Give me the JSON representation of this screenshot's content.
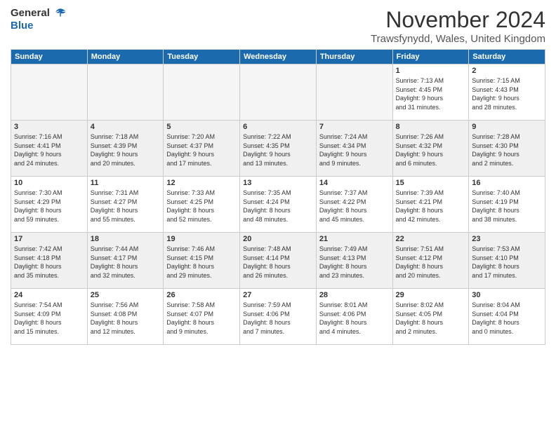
{
  "logo": {
    "line1": "General",
    "line2": "Blue"
  },
  "header": {
    "title": "November 2024",
    "location": "Trawsfynydd, Wales, United Kingdom"
  },
  "weekdays": [
    "Sunday",
    "Monday",
    "Tuesday",
    "Wednesday",
    "Thursday",
    "Friday",
    "Saturday"
  ],
  "weeks": [
    [
      {
        "day": "",
        "info": ""
      },
      {
        "day": "",
        "info": ""
      },
      {
        "day": "",
        "info": ""
      },
      {
        "day": "",
        "info": ""
      },
      {
        "day": "",
        "info": ""
      },
      {
        "day": "1",
        "info": "Sunrise: 7:13 AM\nSunset: 4:45 PM\nDaylight: 9 hours\nand 31 minutes."
      },
      {
        "day": "2",
        "info": "Sunrise: 7:15 AM\nSunset: 4:43 PM\nDaylight: 9 hours\nand 28 minutes."
      }
    ],
    [
      {
        "day": "3",
        "info": "Sunrise: 7:16 AM\nSunset: 4:41 PM\nDaylight: 9 hours\nand 24 minutes."
      },
      {
        "day": "4",
        "info": "Sunrise: 7:18 AM\nSunset: 4:39 PM\nDaylight: 9 hours\nand 20 minutes."
      },
      {
        "day": "5",
        "info": "Sunrise: 7:20 AM\nSunset: 4:37 PM\nDaylight: 9 hours\nand 17 minutes."
      },
      {
        "day": "6",
        "info": "Sunrise: 7:22 AM\nSunset: 4:35 PM\nDaylight: 9 hours\nand 13 minutes."
      },
      {
        "day": "7",
        "info": "Sunrise: 7:24 AM\nSunset: 4:34 PM\nDaylight: 9 hours\nand 9 minutes."
      },
      {
        "day": "8",
        "info": "Sunrise: 7:26 AM\nSunset: 4:32 PM\nDaylight: 9 hours\nand 6 minutes."
      },
      {
        "day": "9",
        "info": "Sunrise: 7:28 AM\nSunset: 4:30 PM\nDaylight: 9 hours\nand 2 minutes."
      }
    ],
    [
      {
        "day": "10",
        "info": "Sunrise: 7:30 AM\nSunset: 4:29 PM\nDaylight: 8 hours\nand 59 minutes."
      },
      {
        "day": "11",
        "info": "Sunrise: 7:31 AM\nSunset: 4:27 PM\nDaylight: 8 hours\nand 55 minutes."
      },
      {
        "day": "12",
        "info": "Sunrise: 7:33 AM\nSunset: 4:25 PM\nDaylight: 8 hours\nand 52 minutes."
      },
      {
        "day": "13",
        "info": "Sunrise: 7:35 AM\nSunset: 4:24 PM\nDaylight: 8 hours\nand 48 minutes."
      },
      {
        "day": "14",
        "info": "Sunrise: 7:37 AM\nSunset: 4:22 PM\nDaylight: 8 hours\nand 45 minutes."
      },
      {
        "day": "15",
        "info": "Sunrise: 7:39 AM\nSunset: 4:21 PM\nDaylight: 8 hours\nand 42 minutes."
      },
      {
        "day": "16",
        "info": "Sunrise: 7:40 AM\nSunset: 4:19 PM\nDaylight: 8 hours\nand 38 minutes."
      }
    ],
    [
      {
        "day": "17",
        "info": "Sunrise: 7:42 AM\nSunset: 4:18 PM\nDaylight: 8 hours\nand 35 minutes."
      },
      {
        "day": "18",
        "info": "Sunrise: 7:44 AM\nSunset: 4:17 PM\nDaylight: 8 hours\nand 32 minutes."
      },
      {
        "day": "19",
        "info": "Sunrise: 7:46 AM\nSunset: 4:15 PM\nDaylight: 8 hours\nand 29 minutes."
      },
      {
        "day": "20",
        "info": "Sunrise: 7:48 AM\nSunset: 4:14 PM\nDaylight: 8 hours\nand 26 minutes."
      },
      {
        "day": "21",
        "info": "Sunrise: 7:49 AM\nSunset: 4:13 PM\nDaylight: 8 hours\nand 23 minutes."
      },
      {
        "day": "22",
        "info": "Sunrise: 7:51 AM\nSunset: 4:12 PM\nDaylight: 8 hours\nand 20 minutes."
      },
      {
        "day": "23",
        "info": "Sunrise: 7:53 AM\nSunset: 4:10 PM\nDaylight: 8 hours\nand 17 minutes."
      }
    ],
    [
      {
        "day": "24",
        "info": "Sunrise: 7:54 AM\nSunset: 4:09 PM\nDaylight: 8 hours\nand 15 minutes."
      },
      {
        "day": "25",
        "info": "Sunrise: 7:56 AM\nSunset: 4:08 PM\nDaylight: 8 hours\nand 12 minutes."
      },
      {
        "day": "26",
        "info": "Sunrise: 7:58 AM\nSunset: 4:07 PM\nDaylight: 8 hours\nand 9 minutes."
      },
      {
        "day": "27",
        "info": "Sunrise: 7:59 AM\nSunset: 4:06 PM\nDaylight: 8 hours\nand 7 minutes."
      },
      {
        "day": "28",
        "info": "Sunrise: 8:01 AM\nSunset: 4:06 PM\nDaylight: 8 hours\nand 4 minutes."
      },
      {
        "day": "29",
        "info": "Sunrise: 8:02 AM\nSunset: 4:05 PM\nDaylight: 8 hours\nand 2 minutes."
      },
      {
        "day": "30",
        "info": "Sunrise: 8:04 AM\nSunset: 4:04 PM\nDaylight: 8 hours\nand 0 minutes."
      }
    ]
  ]
}
